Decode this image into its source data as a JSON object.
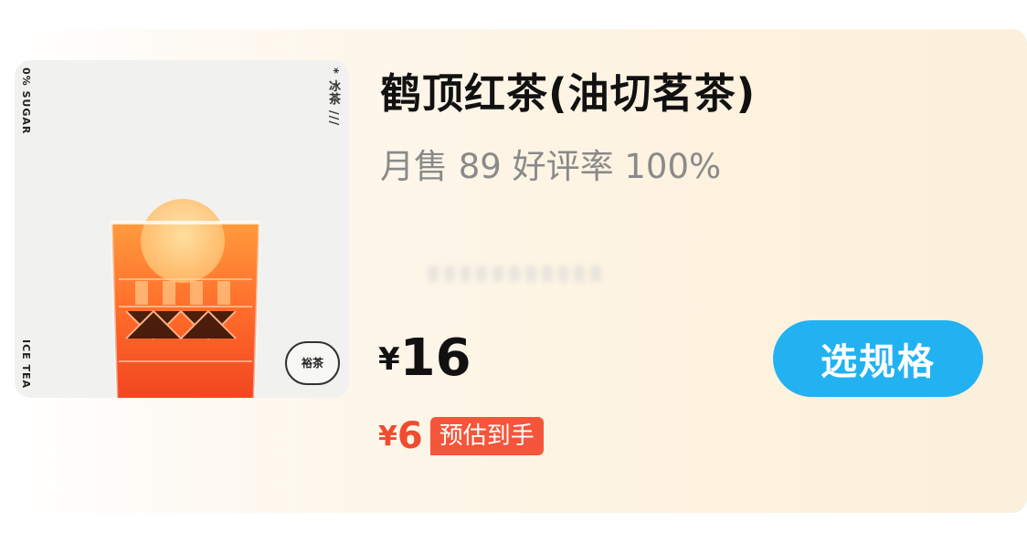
{
  "product": {
    "title": "鹤顶红茶(油切茗茶)",
    "sales_line": "月售 89 好评率 100%",
    "price_symbol": "¥",
    "price": "16",
    "estimated_symbol": "¥",
    "estimated_price": "6",
    "estimated_label": "预估到手",
    "spec_button_label": "选规格"
  },
  "image_text": {
    "sugar": "0% SUGAR",
    "ice_tea": "ICE TEA",
    "chinese": "* 冰茶 ///",
    "brand": "裕茶"
  },
  "colors": {
    "accent_button": "#22b2f2",
    "price_red": "#f24b2f"
  }
}
